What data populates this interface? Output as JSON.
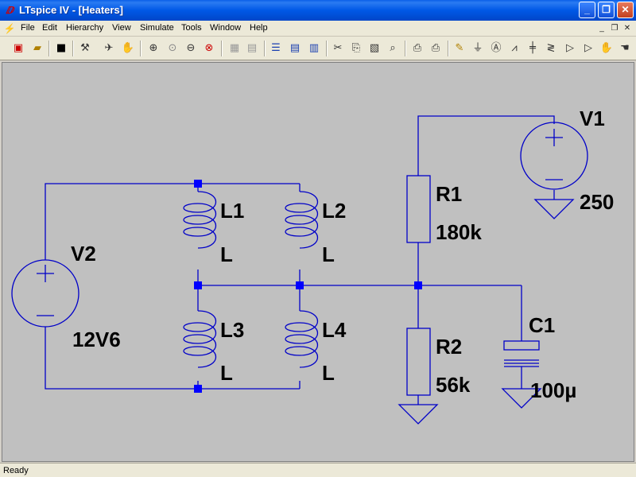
{
  "window": {
    "title": "LTspice IV - [Heaters]"
  },
  "title_buttons": [
    "minimize-icon",
    "restore-icon",
    "close-icon"
  ],
  "menu": [
    "File",
    "Edit",
    "Hierarchy",
    "View",
    "Simulate",
    "Tools",
    "Window",
    "Help"
  ],
  "status": {
    "text": "Ready"
  },
  "colors": {
    "wire": "#0000c8",
    "junction": "#0000ff",
    "canvas": "#c0c0c0"
  },
  "schematic": {
    "components": [
      {
        "ref": "V1",
        "value": "250"
      },
      {
        "ref": "V2",
        "value": "12V6"
      },
      {
        "ref": "R1",
        "value": "180k"
      },
      {
        "ref": "R2",
        "value": "56k"
      },
      {
        "ref": "C1",
        "value": "100µ"
      },
      {
        "ref": "L1",
        "value": "L"
      },
      {
        "ref": "L2",
        "value": "L"
      },
      {
        "ref": "L3",
        "value": "L"
      },
      {
        "ref": "L4",
        "value": "L"
      }
    ]
  }
}
